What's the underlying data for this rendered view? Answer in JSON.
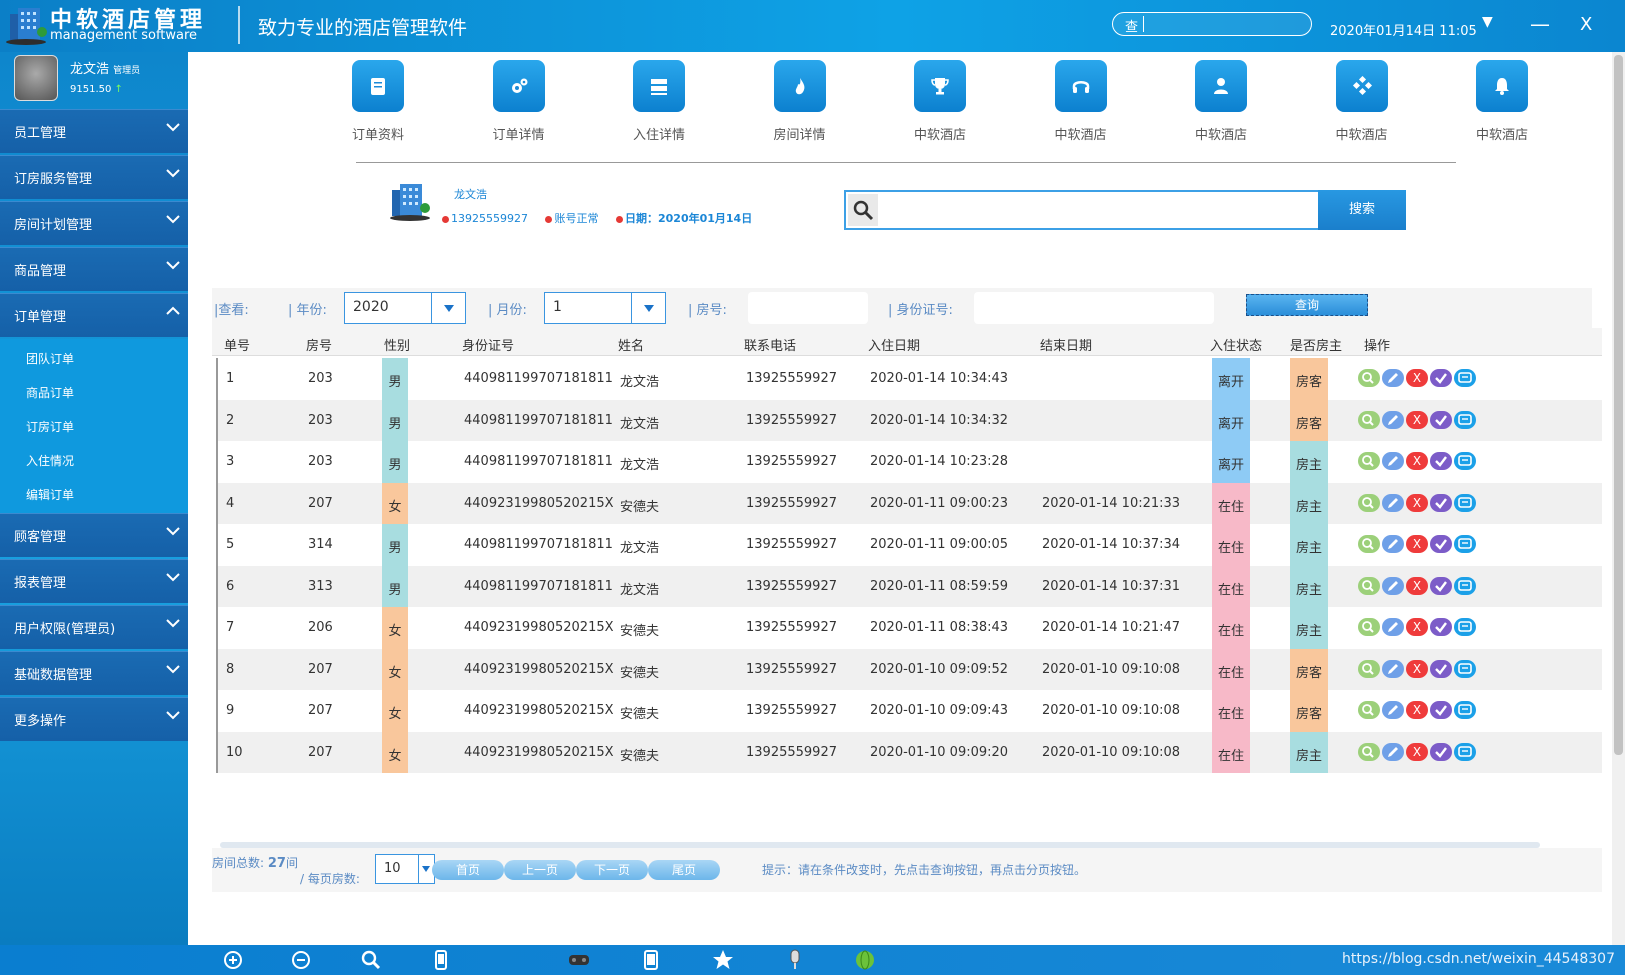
{
  "header": {
    "logo_title": "中软酒店管理",
    "logo_subtitle": "management software",
    "slogan": "致力专业的酒店管理软件",
    "search_label": "查",
    "datetime": "2020年01月14日 11:05",
    "dropdown_icon": "chevron-down-icon",
    "minimize_label": "—",
    "close_label": "X"
  },
  "user": {
    "name": "龙文浩",
    "role": "管理员",
    "balance": "9151.50",
    "balance_trend": "↑"
  },
  "sidebar": {
    "items": [
      {
        "label": "员工管理"
      },
      {
        "label": "订房服务管理"
      },
      {
        "label": "房间计划管理"
      },
      {
        "label": "商品管理"
      },
      {
        "label": "订单管理",
        "open": true
      },
      {
        "label": "顾客管理"
      },
      {
        "label": "报表管理"
      },
      {
        "label": "用户权限(管理员)"
      },
      {
        "label": "基础数据管理"
      },
      {
        "label": "更多操作"
      }
    ],
    "subitems": [
      "团队订单",
      "商品订单",
      "订房订单",
      "入住情况",
      "编辑订单"
    ]
  },
  "toolbar": {
    "items": [
      {
        "label": "订单资料",
        "icon": "book-icon"
      },
      {
        "label": "订单详情",
        "icon": "gears-icon"
      },
      {
        "label": "入住详情",
        "icon": "server-icon"
      },
      {
        "label": "房间详情",
        "icon": "flame-icon"
      },
      {
        "label": "中软酒店",
        "icon": "trophy-icon"
      },
      {
        "label": "中软酒店",
        "icon": "headset-icon"
      },
      {
        "label": "中软酒店",
        "icon": "user-icon"
      },
      {
        "label": "中软酒店",
        "icon": "diamond-grid-icon"
      },
      {
        "label": "中软酒店",
        "icon": "bell-icon"
      }
    ]
  },
  "profile": {
    "name": "龙文浩",
    "phone": "13925559927",
    "status": "账号正常",
    "date": "日期：2020年01月14日"
  },
  "main_search": {
    "placeholder": "",
    "button": "搜索"
  },
  "filter": {
    "view_label": "|查看:",
    "year_label": "| 年份:",
    "year_value": "2020",
    "month_label": "| 月份:",
    "month_value": "1",
    "room_label": "| 房号:",
    "id_label": "| 身份证号:",
    "query_button": "查询"
  },
  "table": {
    "columns": [
      "单号",
      "房号",
      "性别",
      "身份证号",
      "姓名",
      "联系电话",
      "入住日期",
      "结束日期",
      "入住状态",
      "是否房主",
      "操作"
    ],
    "rows": [
      {
        "no": "1",
        "room": "203",
        "sex": "男",
        "id": "440981199707181811",
        "name": "龙文浩",
        "phone": "13925559927",
        "checkin": "2020-01-14 10:34:43",
        "checkout": "",
        "status": "离开",
        "owner": "房客"
      },
      {
        "no": "2",
        "room": "203",
        "sex": "男",
        "id": "440981199707181811",
        "name": "龙文浩",
        "phone": "13925559927",
        "checkin": "2020-01-14 10:34:32",
        "checkout": "",
        "status": "离开",
        "owner": "房客"
      },
      {
        "no": "3",
        "room": "203",
        "sex": "男",
        "id": "440981199707181811",
        "name": "龙文浩",
        "phone": "13925559927",
        "checkin": "2020-01-14 10:23:28",
        "checkout": "",
        "status": "离开",
        "owner": "房主"
      },
      {
        "no": "4",
        "room": "207",
        "sex": "女",
        "id": "44092319980520215X",
        "name": "安德夫",
        "phone": "13925559927",
        "checkin": "2020-01-11 09:00:23",
        "checkout": "2020-01-14 10:21:33",
        "status": "在住",
        "owner": "房主"
      },
      {
        "no": "5",
        "room": "314",
        "sex": "男",
        "id": "440981199707181811",
        "name": "龙文浩",
        "phone": "13925559927",
        "checkin": "2020-01-11 09:00:05",
        "checkout": "2020-01-14 10:37:34",
        "status": "在住",
        "owner": "房主"
      },
      {
        "no": "6",
        "room": "313",
        "sex": "男",
        "id": "440981199707181811",
        "name": "龙文浩",
        "phone": "13925559927",
        "checkin": "2020-01-11 08:59:59",
        "checkout": "2020-01-14 10:37:31",
        "status": "在住",
        "owner": "房主"
      },
      {
        "no": "7",
        "room": "206",
        "sex": "女",
        "id": "44092319980520215X",
        "name": "安德夫",
        "phone": "13925559927",
        "checkin": "2020-01-11 08:38:43",
        "checkout": "2020-01-14 10:21:47",
        "status": "在住",
        "owner": "房主"
      },
      {
        "no": "8",
        "room": "207",
        "sex": "女",
        "id": "44092319980520215X",
        "name": "安德夫",
        "phone": "13925559927",
        "checkin": "2020-01-10 09:09:52",
        "checkout": "2020-01-10 09:10:08",
        "status": "在住",
        "owner": "房客"
      },
      {
        "no": "9",
        "room": "207",
        "sex": "女",
        "id": "44092319980520215X",
        "name": "安德夫",
        "phone": "13925559927",
        "checkin": "2020-01-10 09:09:43",
        "checkout": "2020-01-10 09:10:08",
        "status": "在住",
        "owner": "房客"
      },
      {
        "no": "10",
        "room": "207",
        "sex": "女",
        "id": "44092319980520215X",
        "name": "安德夫",
        "phone": "13925559927",
        "checkin": "2020-01-10 09:09:20",
        "checkout": "2020-01-10 09:10:08",
        "status": "在住",
        "owner": "房主"
      }
    ],
    "op_icons": [
      "search-icon",
      "pencil-icon",
      "x-icon",
      "check-icon",
      "message-icon"
    ],
    "op_delete_label": "X"
  },
  "colors": {
    "male": "#a8dde0",
    "female": "#f9c79c",
    "left": "#8ecbf5",
    "staying": "#f7b9c8",
    "guest": "#f9c79c",
    "owner": "#a8dde0"
  },
  "pager": {
    "total_label": "房间总数: ",
    "total_value": "27",
    "total_unit": "间",
    "per_page_label": "/ 每页房数:",
    "page_size": "10",
    "first": "首页",
    "prev": "上一页",
    "next": "下一页",
    "last": "尾页",
    "tip": "提示：请在条件改变时，先点击查询按钮，再点击分页按钮。"
  },
  "taskbar": {
    "icons": [
      "zoom-in-icon",
      "zoom-out-icon",
      "search-icon",
      "phone-icon",
      "gamepad-icon",
      "tablet-icon",
      "star-icon",
      "microphone-icon",
      "globe-icon"
    ],
    "watermark": "https://blog.csdn.net/weixin_44548307"
  }
}
